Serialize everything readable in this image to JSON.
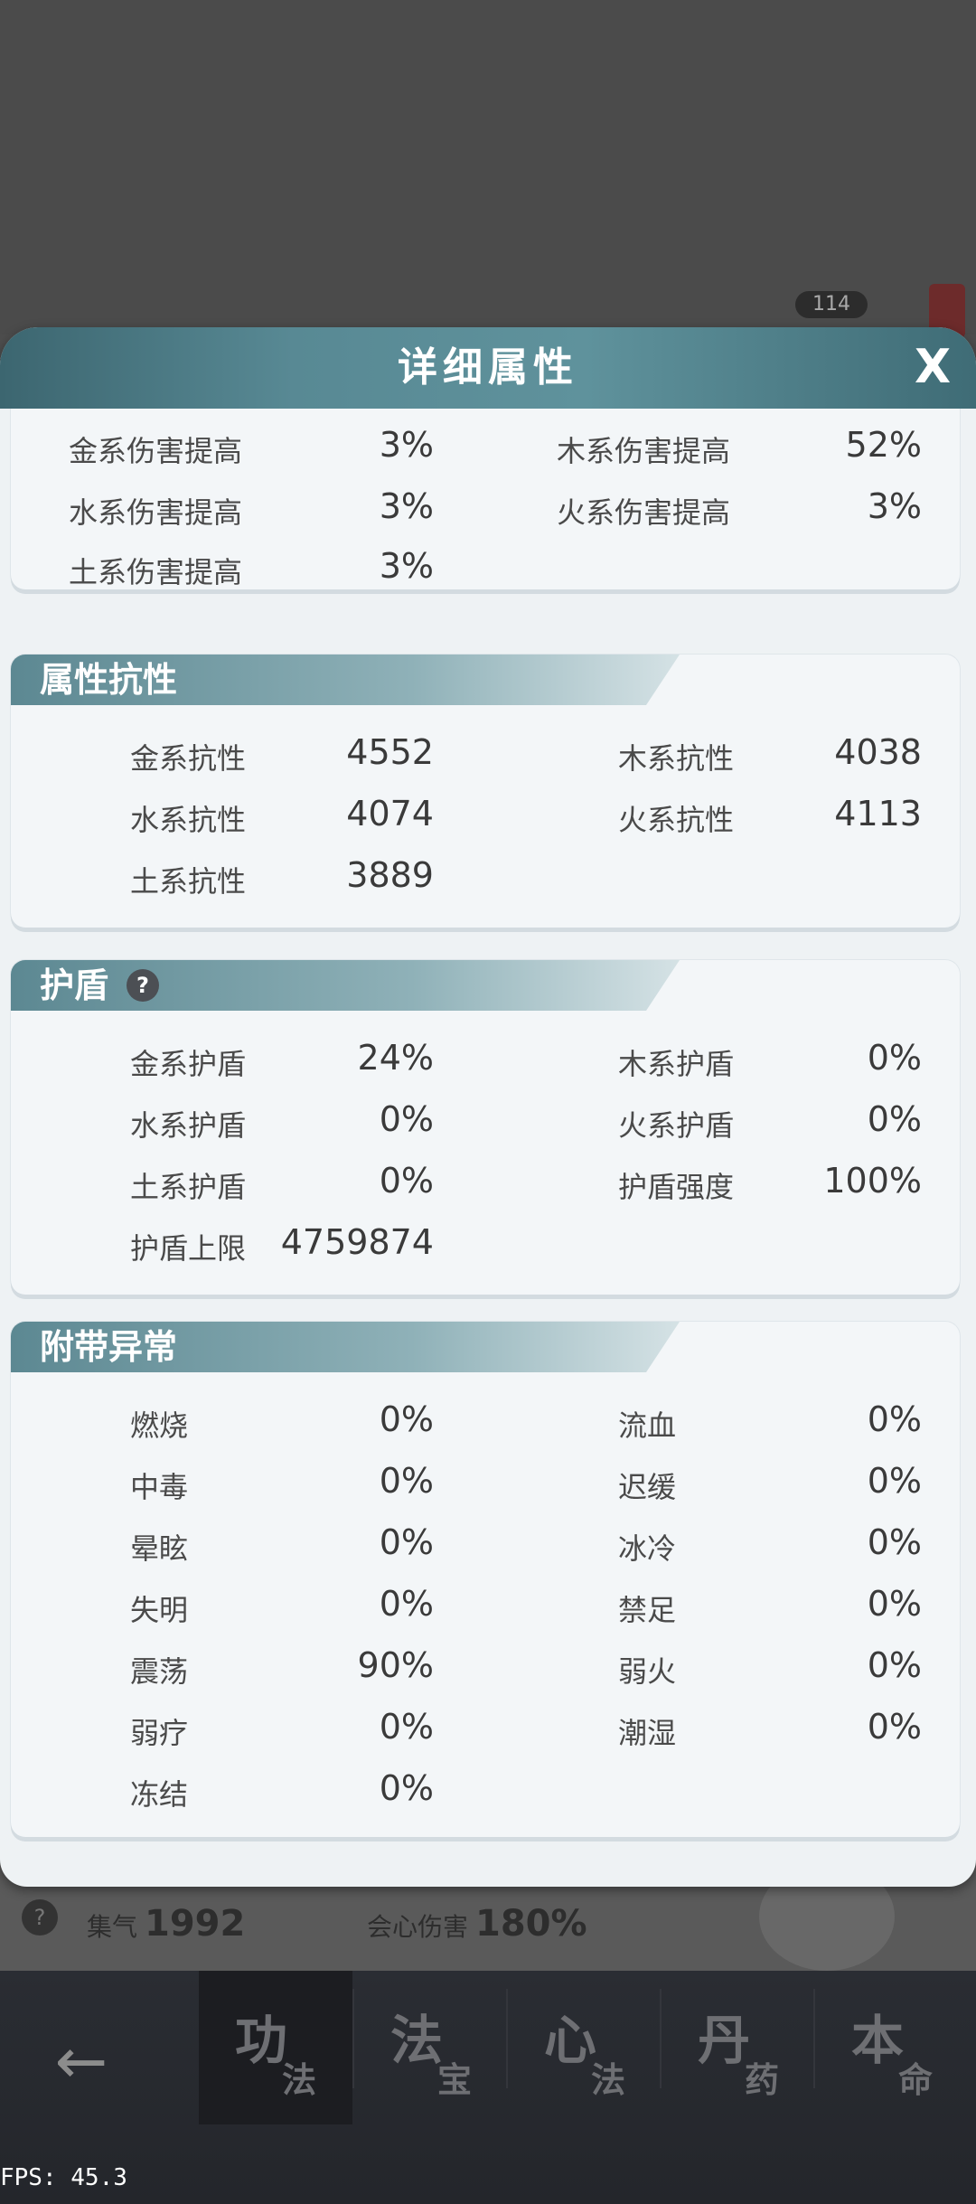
{
  "background": {
    "badge_value": "114",
    "stats": [
      {
        "label": "集气",
        "value": "1992"
      },
      {
        "label": "会心伤害",
        "value": "180%"
      }
    ]
  },
  "modal": {
    "title": "详细属性",
    "close_label": "X",
    "damage_boost": {
      "rows": [
        {
          "label": "金系伤害提高",
          "value": "3%"
        },
        {
          "label": "木系伤害提高",
          "value": "52%"
        },
        {
          "label": "水系伤害提高",
          "value": "3%"
        },
        {
          "label": "火系伤害提高",
          "value": "3%"
        },
        {
          "label": "土系伤害提高",
          "value": "3%"
        }
      ]
    },
    "resistance": {
      "title": "属性抗性",
      "rows": [
        {
          "label": "金系抗性",
          "value": "4552"
        },
        {
          "label": "木系抗性",
          "value": "4038"
        },
        {
          "label": "水系抗性",
          "value": "4074"
        },
        {
          "label": "火系抗性",
          "value": "4113"
        },
        {
          "label": "土系抗性",
          "value": "3889"
        }
      ]
    },
    "shield": {
      "title": "护盾",
      "help": "?",
      "rows": [
        {
          "label": "金系护盾",
          "value": "24%"
        },
        {
          "label": "木系护盾",
          "value": "0%"
        },
        {
          "label": "水系护盾",
          "value": "0%"
        },
        {
          "label": "火系护盾",
          "value": "0%"
        },
        {
          "label": "土系护盾",
          "value": "0%"
        },
        {
          "label": "护盾强度",
          "value": "100%"
        },
        {
          "label": "护盾上限",
          "value": "4759874"
        }
      ]
    },
    "status": {
      "title": "附带异常",
      "rows": [
        {
          "label": "燃烧",
          "value": "0%"
        },
        {
          "label": "流血",
          "value": "0%"
        },
        {
          "label": "中毒",
          "value": "0%"
        },
        {
          "label": "迟缓",
          "value": "0%"
        },
        {
          "label": "晕眩",
          "value": "0%"
        },
        {
          "label": "冰冷",
          "value": "0%"
        },
        {
          "label": "失明",
          "value": "0%"
        },
        {
          "label": "禁足",
          "value": "0%"
        },
        {
          "label": "震荡",
          "value": "90%"
        },
        {
          "label": "弱火",
          "value": "0%"
        },
        {
          "label": "弱疗",
          "value": "0%"
        },
        {
          "label": "潮湿",
          "value": "0%"
        },
        {
          "label": "冻结",
          "value": "0%"
        }
      ]
    }
  },
  "nav": {
    "back_icon": "arrow-left-icon",
    "tabs": [
      {
        "big": "功",
        "small": "法"
      },
      {
        "big": "法",
        "small": "宝"
      },
      {
        "big": "心",
        "small": "法"
      },
      {
        "big": "丹",
        "small": "药"
      },
      {
        "big": "本",
        "small": "命"
      }
    ]
  },
  "fps": "FPS: 45.3"
}
